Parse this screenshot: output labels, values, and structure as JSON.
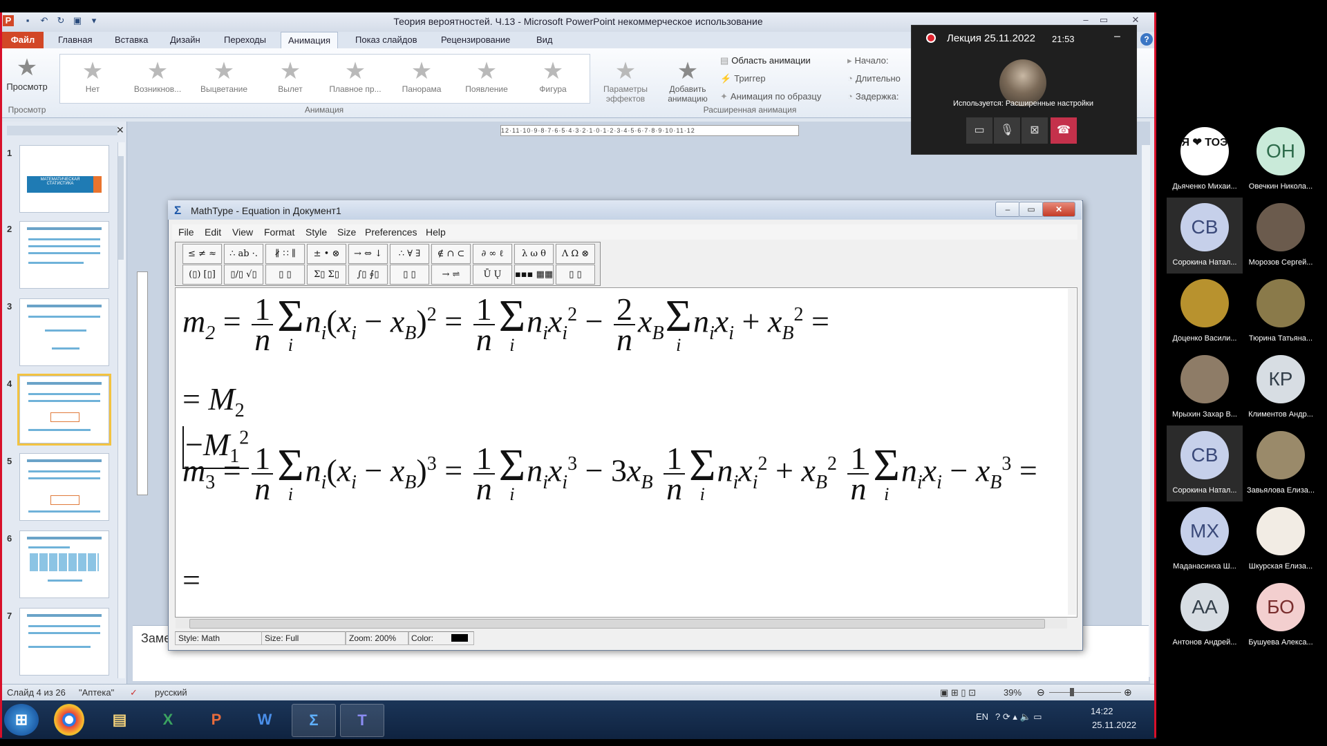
{
  "powerpoint": {
    "title": "Теория вероятностей. Ч.13 - Microsoft PowerPoint некоммерческое использование",
    "tabs": [
      "Файл",
      "Главная",
      "Вставка",
      "Дизайн",
      "Переходы",
      "Анимация",
      "Показ слайдов",
      "Рецензирование",
      "Вид"
    ],
    "active_tab": "Анимация",
    "preview": {
      "label": "Просмотр",
      "group": "Просмотр"
    },
    "animations": [
      "Нет",
      "Возникнов...",
      "Выцветание",
      "Вылет",
      "Плавное пр...",
      "Панорама",
      "Появление",
      "Фигура"
    ],
    "animation_group": "Анимация",
    "effect_params": "Параметры эффектов",
    "add_animation": "Добавить анимацию",
    "advanced": {
      "pane": "Область анимации",
      "trigger": "Триггер",
      "painter": "Анимация по образцу",
      "group": "Расширенная анимация"
    },
    "timing": [
      "Начало:",
      "Длительно",
      "Задержка:"
    ],
    "ruler_h": "12·11·10·9·8·7·6·5·4·3·2·1·0·1·2·3·4·5·6·7·8·9·10·11·12",
    "slide_numbers": [
      "1",
      "2",
      "3",
      "4",
      "5",
      "6",
      "7"
    ],
    "selected_slide": "4",
    "thumb1_title": "МАТЕМАТИЧЕСКАЯ СТАТИСТИКА",
    "notes_placeholder": "Заме",
    "status": {
      "slide": "Слайд 4 из 26",
      "theme": "\"Аптека\"",
      "language": "русский",
      "zoom": "39%"
    }
  },
  "mathtype": {
    "title": "MathType - Equation in Документ1",
    "menu": [
      "File",
      "Edit",
      "View",
      "Format",
      "Style",
      "Size",
      "Preferences",
      "Help"
    ],
    "toolbar_row1": [
      "≤ ≠ ≈",
      "∴ ab ·.",
      "∦ ∷ ∥",
      "± • ⊗",
      "→ ⇔ ↓",
      "∴ ∀ ∃",
      "∉ ∩ ⊂",
      "∂ ∞ ℓ",
      "λ ω θ",
      "Λ Ω ⊗"
    ],
    "toolbar_row2": [
      "(▯) [▯]",
      "▯/▯ √▯",
      "▯ ▯",
      "Σ▯ Σ▯",
      "∫▯ ∮▯",
      "▯ ▯",
      "→ ⇌",
      "Ū Ų",
      "▪▪▪ ▦▦",
      "▯ ▯"
    ],
    "equations": {
      "m2_lhs": "m",
      "m2_sub": "2",
      "m3_lhs": "m",
      "m3_sub": "3",
      "M": "M",
      "M2_sub": "2",
      "M1_sub": "1",
      "M1_sup": "2",
      "n": "n",
      "i": "i",
      "x": "x",
      "B": "B",
      "one": "1",
      "two": "2",
      "three": "3",
      "eq": "=",
      "minus": "−",
      "plus": "+"
    },
    "status": {
      "style": "Style: Math",
      "size": "Size: Full",
      "zoom": "Zoom: 200%",
      "color": "Color:"
    }
  },
  "teams": {
    "title": "Лекция 25.11.2022",
    "time": "21:53",
    "caption": "Используется: Расширенные настройки"
  },
  "participants": [
    {
      "initials": "Я ❤ ТОЭ",
      "name": "Дьяченко Михаи...",
      "bg": "#ffffff",
      "fg": "#111111"
    },
    {
      "initials": "ОН",
      "name": "Овечкин Никола...",
      "bg": "#c9ead9",
      "fg": "#2d6b4b"
    },
    {
      "initials": "СВ",
      "name": "Сорокина Натал...",
      "bg": "#c6d0ea",
      "fg": "#3b4a7a",
      "highlight": true
    },
    {
      "initials": "",
      "name": "Морозов Сергей...",
      "bg": "#6b5b4d",
      "fg": "#ffffff"
    },
    {
      "initials": "",
      "name": "Доценко Васили...",
      "bg": "#b8922e",
      "fg": "#ffffff"
    },
    {
      "initials": "",
      "name": "Тюрина Татьяна...",
      "bg": "#8a7a4a",
      "fg": "#ffffff"
    },
    {
      "initials": "",
      "name": "Мрыхин Захар В...",
      "bg": "#8e7c67",
      "fg": "#ffffff"
    },
    {
      "initials": "КР",
      "name": "Климентов Андр...",
      "bg": "#d7dde3",
      "fg": "#333f4a"
    },
    {
      "initials": "СВ",
      "name": "Сорокина Натал...",
      "bg": "#c6d0ea",
      "fg": "#3b4a7a",
      "highlight": true
    },
    {
      "initials": "",
      "name": "Завьялова Елиза...",
      "bg": "#9a8a6a",
      "fg": "#ffffff"
    },
    {
      "initials": "МХ",
      "name": "Маданасинха Ш...",
      "bg": "#c6d0ea",
      "fg": "#3b4a7a"
    },
    {
      "initials": "",
      "name": "Шкурская Елиза...",
      "bg": "#f2ece4",
      "fg": "#444444"
    },
    {
      "initials": "АА",
      "name": "Антонов Андрей...",
      "bg": "#d7dde3",
      "fg": "#333f4a"
    },
    {
      "initials": "БО",
      "name": "Бушуева Алекса...",
      "bg": "#f3cfcf",
      "fg": "#7a2e2e"
    }
  ],
  "taskbar": {
    "lang": "EN",
    "time": "14:22",
    "date": "25.11.2022"
  },
  "icons": [
    "windows-start-icon",
    "chrome-icon",
    "explorer-icon",
    "excel-icon",
    "powerpoint-icon",
    "word-icon",
    "mathtype-icon",
    "teams-icon"
  ]
}
